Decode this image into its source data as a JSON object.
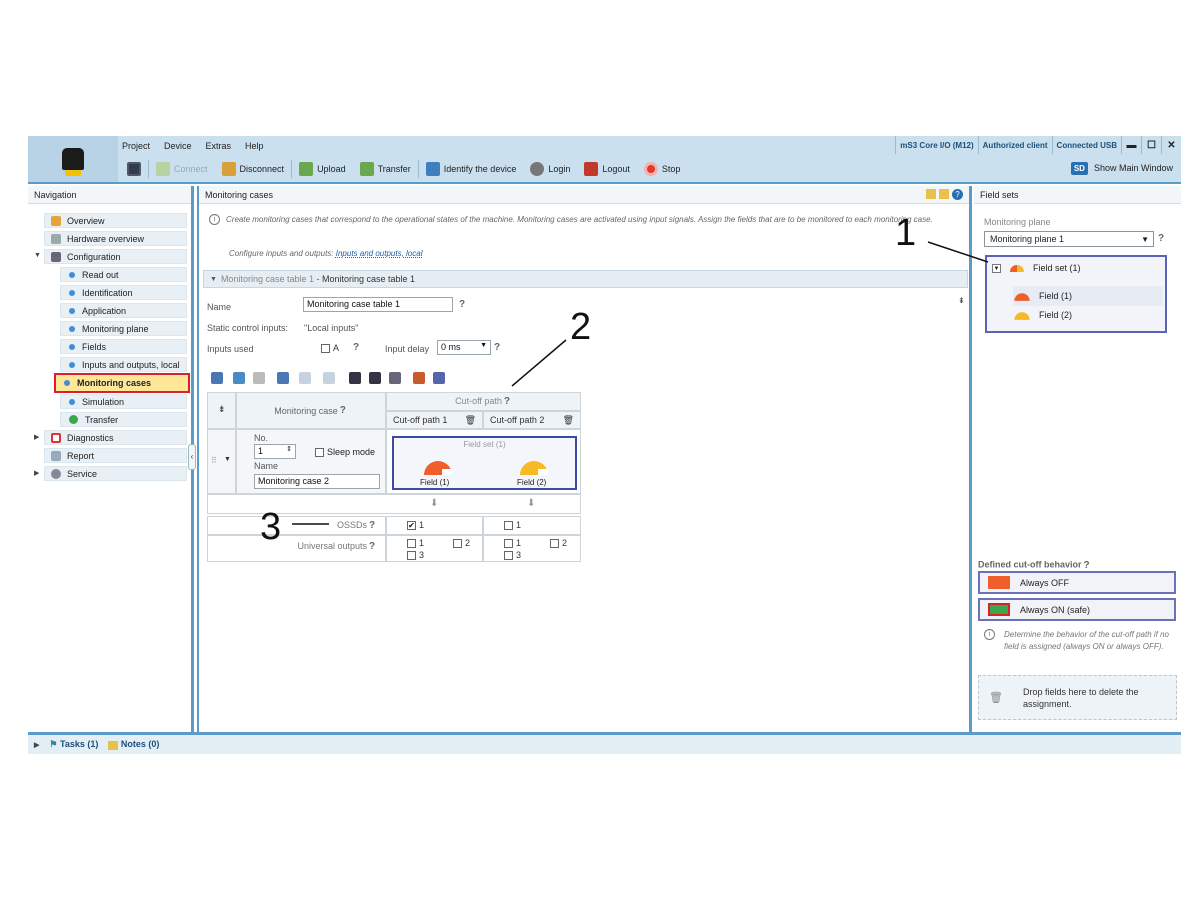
{
  "menu": {
    "project": "Project",
    "device": "Device",
    "extras": "Extras",
    "help": "Help"
  },
  "status": {
    "device": "mS3 Core I/O (M12)",
    "client": "Authorized client",
    "connection": "Connected USB"
  },
  "window_controls": {
    "minimize": "▬",
    "maximize": "☐",
    "close": "✕"
  },
  "toolbar": {
    "connect": "Connect",
    "disconnect": "Disconnect",
    "upload": "Upload",
    "transfer": "Transfer",
    "identify": "Identify the device",
    "login": "Login",
    "logout": "Logout",
    "stop": "Stop",
    "show_main_badge": "SD",
    "show_main": "Show Main Window"
  },
  "nav": {
    "title": "Navigation",
    "items": {
      "overview": "Overview",
      "hardware": "Hardware overview",
      "configuration": "Configuration",
      "readout": "Read out",
      "identification": "Identification",
      "application": "Application",
      "monitoring_plane": "Monitoring plane",
      "fields": "Fields",
      "io_local": "Inputs and outputs, local",
      "monitoring_cases": "Monitoring cases",
      "simulation": "Simulation",
      "transfer": "Transfer",
      "diagnostics": "Diagnostics",
      "report": "Report",
      "service": "Service"
    }
  },
  "main": {
    "title": "Monitoring cases",
    "info_text": "Create monitoring cases that correspond to the operational states of the machine. Monitoring cases are activated using input signals. Assign the fields that are to be monitored to each monitoring case.",
    "configure_prefix": "Configure inputs and outputs:",
    "configure_link": "Inputs and outputs, local",
    "section_breadcrumb": "Monitoring case table 1",
    "section_title": "Monitoring case table 1",
    "name_label": "Name",
    "name_value": "Monitoring case table 1",
    "static_inputs_label": "Static control inputs:",
    "static_inputs_value": "\"Local inputs\"",
    "inputs_used_label": "Inputs used",
    "input_a": "A",
    "input_delay_label": "Input delay",
    "input_delay_value": "0 ms",
    "grid": {
      "monitoring_case_header": "Monitoring case",
      "cutoff_header": "Cut-off path",
      "cutoff_1": "Cut-off path 1",
      "cutoff_2": "Cut-off path 2",
      "no_label": "No.",
      "no_value": "1",
      "sleep_mode": "Sleep mode",
      "name_label": "Name",
      "name_value": "Monitoring case 2",
      "field_set": "Field set (1)",
      "field_1": "Field (1)",
      "field_2": "Field (2)",
      "ossds": "OSSDs",
      "universal_outputs": "Universal outputs",
      "ossd_1_a": "1",
      "ossd_1_b": "1",
      "uo_1": "1",
      "uo_2": "2",
      "uo_3": "3",
      "uo_b1": "1",
      "uo_b2": "2",
      "uo_b3": "3"
    }
  },
  "right": {
    "title": "Field sets",
    "monitoring_plane_label": "Monitoring plane",
    "monitoring_plane_value": "Monitoring plane 1",
    "field_set": "Field set (1)",
    "field_1": "Field (1)",
    "field_2": "Field (2)",
    "defined_cutoff": "Defined cut-off behavior",
    "always_off": "Always OFF",
    "always_on": "Always ON (safe)",
    "cutoff_info": "Determine the behavior of the cut-off path if no field is assigned (always ON or always OFF).",
    "drop_text": "Drop fields here to delete the assignment."
  },
  "bottom": {
    "tasks": "Tasks (1)",
    "notes": "Notes (0)"
  },
  "annotations": {
    "one": "1",
    "two": "2",
    "three": "3"
  },
  "colors": {
    "accent": "#5a9cc7",
    "field_red": "#f25d2c",
    "field_yellow": "#f7b924",
    "active_nav": "#ffe79a",
    "highlight_border": "#d9212c"
  }
}
